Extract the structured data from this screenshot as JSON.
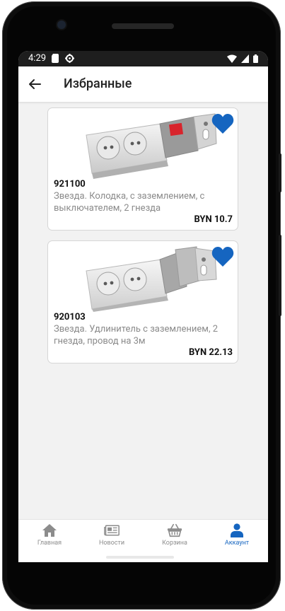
{
  "status": {
    "time": "4:29"
  },
  "appbar": {
    "title": "Избранные"
  },
  "products": [
    {
      "code": "921100",
      "description": "Звезда. Колодка, с заземлением, с выключателем, 2 гнезда",
      "price": "BYN 10.7",
      "favorite": true
    },
    {
      "code": "920103",
      "description": "Звезда. Удлинитель с заземлением, 2 гнезда, провод на 3м",
      "price": "BYN 22.13",
      "favorite": true
    }
  ],
  "bottom_nav": [
    {
      "label": "Главная",
      "icon": "home-icon"
    },
    {
      "label": "Новости",
      "icon": "news-icon"
    },
    {
      "label": "Корзина",
      "icon": "basket-icon"
    },
    {
      "label": "Аккаунт",
      "icon": "account-icon",
      "active": true
    }
  ],
  "colors": {
    "accent": "#1565c0",
    "heart": "#1565c0",
    "background": "#f2f2f2"
  }
}
